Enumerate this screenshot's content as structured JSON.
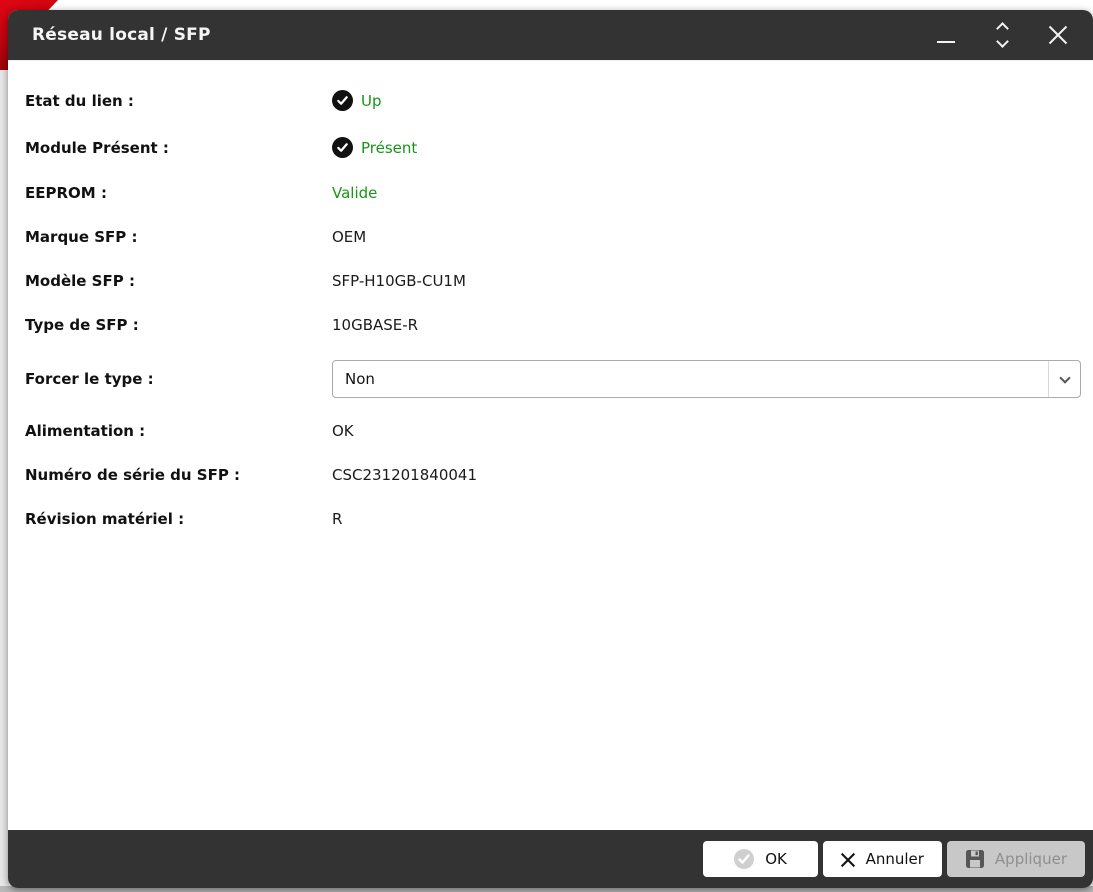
{
  "window": {
    "title": "Réseau local / SFP",
    "controls": {
      "minimize": "minimize",
      "resize": "resize",
      "close": "close"
    }
  },
  "form": {
    "rows": [
      {
        "label": "Etat du lien :",
        "value": "Up",
        "type": "status-check-green",
        "icon": "check-circle-icon"
      },
      {
        "label": "Module Présent :",
        "value": "Présent",
        "type": "status-check-green",
        "icon": "check-circle-icon"
      },
      {
        "label": "EEPROM :",
        "value": "Valide",
        "type": "text-green"
      },
      {
        "label": "Marque SFP :",
        "value": "OEM",
        "type": "text"
      },
      {
        "label": "Modèle SFP :",
        "value": "SFP-H10GB-CU1M",
        "type": "text"
      },
      {
        "label": "Type de SFP :",
        "value": "10GBASE-R",
        "type": "text"
      },
      {
        "label": "Forcer le type :",
        "value": "Non",
        "type": "select"
      },
      {
        "label": "Alimentation :",
        "value": "OK",
        "type": "text"
      },
      {
        "label": "Numéro de série du SFP :",
        "value": "CSC231201840041",
        "type": "text"
      },
      {
        "label": "Révision matériel :",
        "value": "R",
        "type": "text"
      }
    ]
  },
  "footer": {
    "buttons": [
      {
        "label": "OK",
        "icon": "check-circle-icon",
        "enabled": true,
        "icon_state": "disabled-gray"
      },
      {
        "label": "Annuler",
        "icon": "x-icon",
        "enabled": true
      },
      {
        "label": "Appliquer",
        "icon": "save-floppy-icon",
        "enabled": false
      }
    ]
  },
  "colors": {
    "titlebar": "#333333",
    "status_green": "#199419",
    "corner_red": "#cf0110",
    "disabled_button_bg": "#c8c8c8"
  }
}
